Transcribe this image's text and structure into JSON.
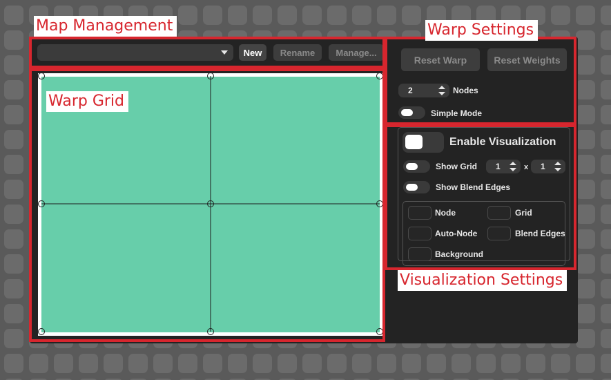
{
  "callouts": {
    "map_management": "Map Management",
    "warp_settings": "Warp Settings",
    "warp_grid": "Warp Grid",
    "visualization_settings": "Visualization Settings"
  },
  "map_management": {
    "dropdown_value": "",
    "new_label": "New",
    "rename_label": "Rename",
    "manage_label": "Manage..."
  },
  "warp_settings": {
    "reset_warp_label": "Reset Warp",
    "reset_weights_label": "Reset Weights",
    "nodes_value": "2",
    "nodes_label": "Nodes",
    "simple_mode_label": "Simple Mode",
    "simple_mode_on": false
  },
  "visualization": {
    "enable_label": "Enable Visualization",
    "enabled": false,
    "show_grid_label": "Show Grid",
    "grid_x_value": "1",
    "grid_times": "x",
    "grid_y_value": "1",
    "show_blend_edges_label": "Show Blend Edges",
    "checkboxes": {
      "node": "Node",
      "grid": "Grid",
      "auto_node": "Auto-Node",
      "blend_edges": "Blend Edges",
      "background": "Background"
    }
  },
  "warp_grid": {
    "columns": 2,
    "rows": 2,
    "fill_color": "#67ceaa",
    "line_color": "#1e1e1e"
  },
  "colors": {
    "highlight_red": "#d7262e",
    "panel_bg": "#232323",
    "control_bg": "#3d3d3d",
    "page_bg": "#5a5a5a"
  }
}
